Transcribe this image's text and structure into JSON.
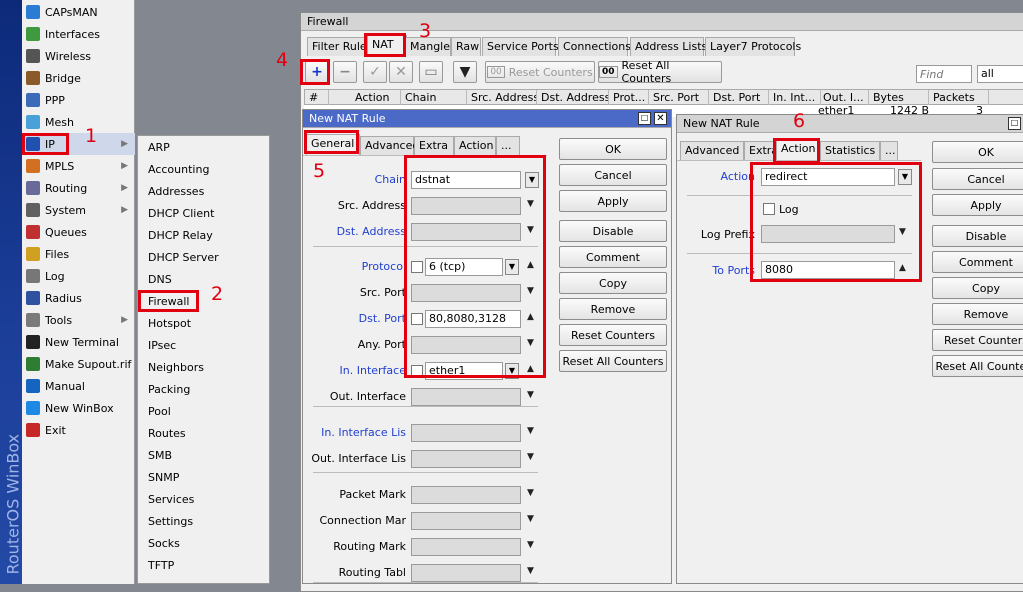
{
  "brand": "RouterOS WinBox",
  "menu": [
    {
      "label": "CAPsMAN",
      "icon": "capsman-icon",
      "arrow": false
    },
    {
      "label": "Interfaces",
      "icon": "interfaces-icon",
      "arrow": false
    },
    {
      "label": "Wireless",
      "icon": "wireless-icon",
      "arrow": false
    },
    {
      "label": "Bridge",
      "icon": "bridge-icon",
      "arrow": false
    },
    {
      "label": "PPP",
      "icon": "ppp-icon",
      "arrow": false
    },
    {
      "label": "Mesh",
      "icon": "mesh-icon",
      "arrow": false
    },
    {
      "label": "IP",
      "icon": "ip-icon",
      "arrow": true
    },
    {
      "label": "MPLS",
      "icon": "mpls-icon",
      "arrow": true
    },
    {
      "label": "Routing",
      "icon": "routing-icon",
      "arrow": true
    },
    {
      "label": "System",
      "icon": "system-icon",
      "arrow": true
    },
    {
      "label": "Queues",
      "icon": "queues-icon",
      "arrow": false
    },
    {
      "label": "Files",
      "icon": "files-icon",
      "arrow": false
    },
    {
      "label": "Log",
      "icon": "log-icon",
      "arrow": false
    },
    {
      "label": "Radius",
      "icon": "radius-icon",
      "arrow": false
    },
    {
      "label": "Tools",
      "icon": "tools-icon",
      "arrow": true
    },
    {
      "label": "New Terminal",
      "icon": "terminal-icon",
      "arrow": false
    },
    {
      "label": "Make Supout.rif",
      "icon": "supout-icon",
      "arrow": false
    },
    {
      "label": "Manual",
      "icon": "manual-icon",
      "arrow": false
    },
    {
      "label": "New WinBox",
      "icon": "winbox-icon",
      "arrow": false
    },
    {
      "label": "Exit",
      "icon": "exit-icon",
      "arrow": false
    }
  ],
  "ip_submenu": [
    "ARP",
    "Accounting",
    "Addresses",
    "DHCP Client",
    "DHCP Relay",
    "DHCP Server",
    "DNS",
    "Firewall",
    "Hotspot",
    "IPsec",
    "Neighbors",
    "Packing",
    "Pool",
    "Routes",
    "SMB",
    "SNMP",
    "Services",
    "Settings",
    "Socks",
    "TFTP"
  ],
  "firewall": {
    "title": "Firewall",
    "tabs": [
      "Filter Rules",
      "NAT",
      "Mangle",
      "Raw",
      "Service Ports",
      "Connections",
      "Address Lists",
      "Layer7 Protocols"
    ],
    "reset_counters": "Reset Counters",
    "reset_all_counters": "Reset All Counters",
    "counter_badge": "00",
    "find_placeholder": "Find",
    "filter_value": "all",
    "columns": [
      "#",
      "Action",
      "Chain",
      "Src. Address",
      "Dst. Address",
      "Prot...",
      "Src. Port",
      "Dst. Port",
      "In. Int...",
      "Out. I...",
      "Bytes",
      "Packets"
    ],
    "row": {
      "out_interface": "ether1",
      "bytes": "1242 B",
      "packets": "3"
    }
  },
  "nat1": {
    "title": "New NAT Rule",
    "tabs": [
      "General",
      "Advanced",
      "Extra",
      "Action",
      "..."
    ],
    "fields": {
      "chain": {
        "label": "Chain",
        "value": "dstnat"
      },
      "src_address": {
        "label": "Src. Address"
      },
      "dst_address": {
        "label": "Dst. Address"
      },
      "protocol": {
        "label": "Protocol",
        "value": "6 (tcp)"
      },
      "src_port": {
        "label": "Src. Port"
      },
      "dst_port": {
        "label": "Dst. Port",
        "value": "80,8080,3128"
      },
      "any_port": {
        "label": "Any. Port"
      },
      "in_interface": {
        "label": "In. Interface",
        "value": "ether1"
      },
      "out_interface": {
        "label": "Out. Interface"
      },
      "in_interface_list": {
        "label": "In. Interface Lis"
      },
      "out_interface_list": {
        "label": "Out. Interface Lis"
      },
      "packet_mark": {
        "label": "Packet Mark"
      },
      "connection_mark": {
        "label": "Connection Mar"
      },
      "routing_mark": {
        "label": "Routing Mark"
      },
      "routing_table": {
        "label": "Routing Tabl"
      }
    },
    "buttons": [
      "OK",
      "Cancel",
      "Apply",
      "Disable",
      "Comment",
      "Copy",
      "Remove",
      "Reset Counters",
      "Reset All Counters"
    ]
  },
  "nat2": {
    "title": "New NAT Rule",
    "tabs": [
      "Advanced",
      "Extra",
      "Action",
      "Statistics",
      "..."
    ],
    "fields": {
      "action": {
        "label": "Action",
        "value": "redirect"
      },
      "log": {
        "label": "Log"
      },
      "log_prefix": {
        "label": "Log Prefix"
      },
      "to_ports": {
        "label": "To Ports",
        "value": "8080"
      }
    },
    "buttons": [
      "OK",
      "Cancel",
      "Apply",
      "Disable",
      "Comment",
      "Copy",
      "Remove",
      "Reset Counters",
      "Reset All Counters"
    ]
  },
  "annotations": [
    "1",
    "2",
    "3",
    "4",
    "5",
    "6"
  ],
  "colors": {
    "annotation": "#e0000f",
    "link_label": "#1f3fd0",
    "title_active": "#4b69c6"
  }
}
